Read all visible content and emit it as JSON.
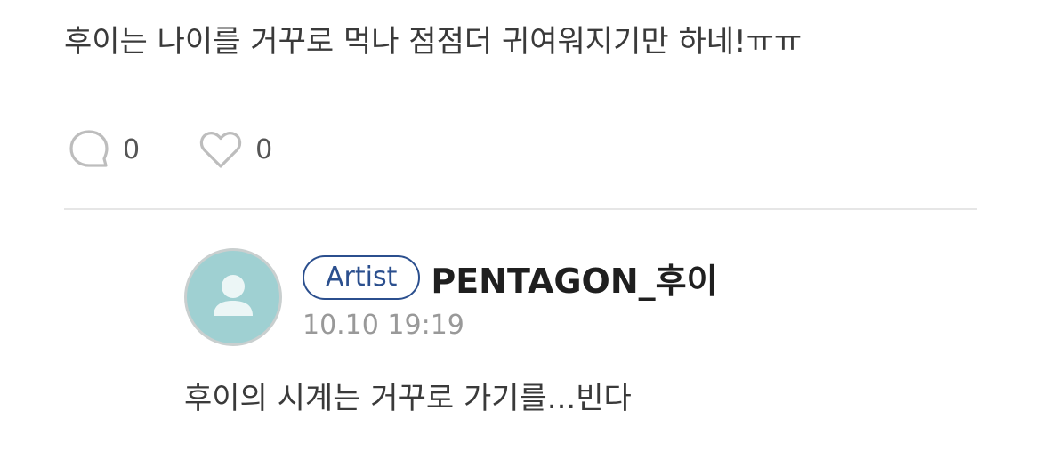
{
  "post": {
    "text": "후이는 나이를 거꾸로 먹나 점점더 귀여워지기만 하네!ㅠㅠ",
    "comment_count": "0",
    "like_count": "0"
  },
  "reply": {
    "badge": "Artist",
    "author": "PENTAGON_후이",
    "timestamp": "10.10 19:19",
    "text": "후이의 시계는 거꾸로 가기를...빈다"
  },
  "icons": {
    "comment": "speech-bubble-icon",
    "like": "heart-icon",
    "avatar": "user-silhouette-icon"
  },
  "colors": {
    "badge": "#2b4f8e",
    "avatar_bg": "#9fd0d2",
    "icon_stroke": "#bdbdbd",
    "timestamp": "#999999"
  }
}
